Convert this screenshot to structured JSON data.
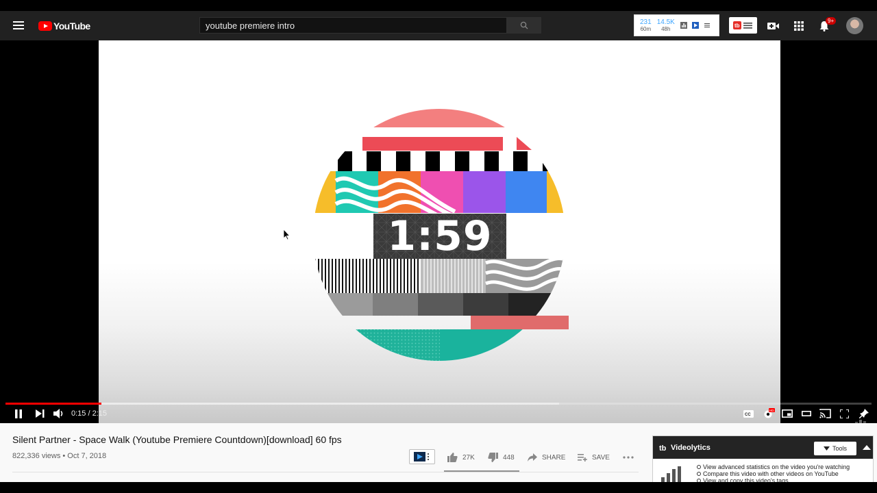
{
  "header": {
    "logo_text": "YouTube",
    "search_value": "youtube premiere intro",
    "stats": [
      {
        "value": "231",
        "period": "60m"
      },
      {
        "value": "14.5K",
        "period": "48h"
      }
    ],
    "notification_count": "9+"
  },
  "video": {
    "countdown_text": "1:59",
    "time_display": "0:15 / 2:15",
    "progress_played": 0.111,
    "progress_buffered": 0.639,
    "accent_color": "#ff0000"
  },
  "info": {
    "title": "Silent Partner - Space Walk (Youtube Premiere Countdown)[download] 60 fps",
    "meta": "822,336 views • Oct 7, 2018",
    "likes": "27K",
    "dislikes": "448",
    "share_label": "SHARE",
    "save_label": "SAVE"
  },
  "videolytics": {
    "title": "Videolytics",
    "tools_label": "Tools",
    "items": [
      "View advanced statistics on the video you're watching",
      "Compare this video with other videos on YouTube",
      "View and copy this video's tags"
    ]
  }
}
